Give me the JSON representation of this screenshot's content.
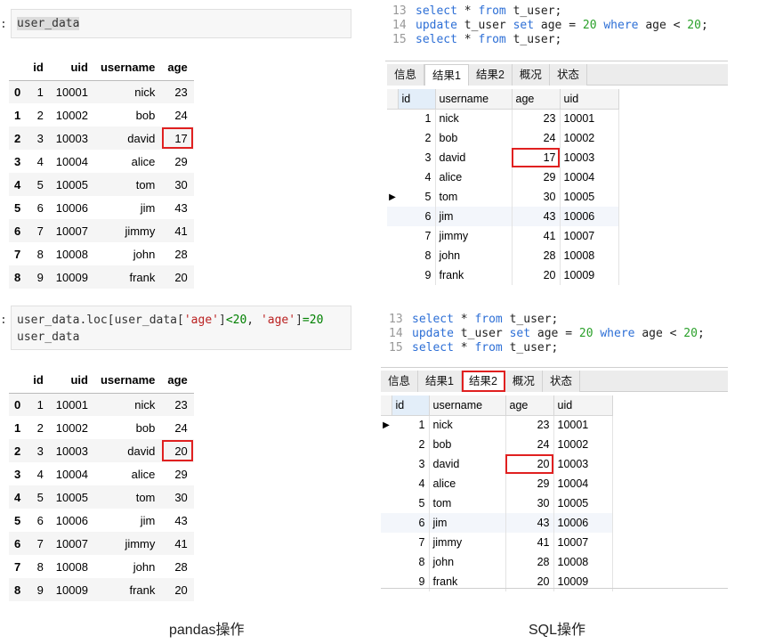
{
  "pandas": {
    "prompt": ":",
    "cell1_code": "user_data",
    "cell2": {
      "prefix": "user_data.loc[user_data[",
      "str1": "'age'",
      "mid1": "]",
      "op1": "<",
      "num1": "20",
      "mid2": ", ",
      "str2": "'age'",
      "mid3": "]",
      "op2": "=",
      "num2": "20",
      "line2": "user_data"
    },
    "columns": [
      "",
      "id",
      "uid",
      "username",
      "age"
    ],
    "table_before": [
      [
        "0",
        "1",
        "10001",
        "nick",
        "23"
      ],
      [
        "1",
        "2",
        "10002",
        "bob",
        "24"
      ],
      [
        "2",
        "3",
        "10003",
        "david",
        "17"
      ],
      [
        "3",
        "4",
        "10004",
        "alice",
        "29"
      ],
      [
        "4",
        "5",
        "10005",
        "tom",
        "30"
      ],
      [
        "5",
        "6",
        "10006",
        "jim",
        "43"
      ],
      [
        "6",
        "7",
        "10007",
        "jimmy",
        "41"
      ],
      [
        "7",
        "8",
        "10008",
        "john",
        "28"
      ],
      [
        "8",
        "9",
        "10009",
        "frank",
        "20"
      ]
    ],
    "table_after": [
      [
        "0",
        "1",
        "10001",
        "nick",
        "23"
      ],
      [
        "1",
        "2",
        "10002",
        "bob",
        "24"
      ],
      [
        "2",
        "3",
        "10003",
        "david",
        "20"
      ],
      [
        "3",
        "4",
        "10004",
        "alice",
        "29"
      ],
      [
        "4",
        "5",
        "10005",
        "tom",
        "30"
      ],
      [
        "5",
        "6",
        "10006",
        "jim",
        "43"
      ],
      [
        "6",
        "7",
        "10007",
        "jimmy",
        "41"
      ],
      [
        "7",
        "8",
        "10008",
        "john",
        "28"
      ],
      [
        "8",
        "9",
        "10009",
        "frank",
        "20"
      ]
    ],
    "caption": "pandas操作"
  },
  "sql": {
    "code_lines": [
      {
        "ln": "13",
        "parts": [
          [
            "kw",
            "select"
          ],
          [
            "plain",
            " * "
          ],
          [
            "kw",
            "from"
          ],
          [
            "plain",
            " t_user;"
          ]
        ]
      },
      {
        "ln": "14",
        "parts": [
          [
            "kw",
            "update"
          ],
          [
            "plain",
            " t_user "
          ],
          [
            "kw",
            "set"
          ],
          [
            "plain",
            " age = "
          ],
          [
            "num",
            "20"
          ],
          [
            "plain",
            " "
          ],
          [
            "kw",
            "where"
          ],
          [
            "plain",
            " age < "
          ],
          [
            "num",
            "20"
          ],
          [
            "plain",
            ";"
          ]
        ]
      },
      {
        "ln": "15",
        "parts": [
          [
            "kw",
            "select"
          ],
          [
            "plain",
            " * "
          ],
          [
            "kw",
            "from"
          ],
          [
            "plain",
            " t_user;"
          ]
        ]
      }
    ],
    "tabs": [
      "信息",
      "结果1",
      "结果2",
      "概况",
      "状态"
    ],
    "columns": [
      "id",
      "username",
      "age",
      "uid"
    ],
    "result1": [
      [
        "1",
        "nick",
        "23",
        "10001"
      ],
      [
        "2",
        "bob",
        "24",
        "10002"
      ],
      [
        "3",
        "david",
        "17",
        "10003"
      ],
      [
        "4",
        "alice",
        "29",
        "10004"
      ],
      [
        "5",
        "tom",
        "30",
        "10005"
      ],
      [
        "6",
        "jim",
        "43",
        "10006"
      ],
      [
        "7",
        "jimmy",
        "41",
        "10007"
      ],
      [
        "8",
        "john",
        "28",
        "10008"
      ],
      [
        "9",
        "frank",
        "20",
        "10009"
      ]
    ],
    "result2": [
      [
        "1",
        "nick",
        "23",
        "10001"
      ],
      [
        "2",
        "bob",
        "24",
        "10002"
      ],
      [
        "3",
        "david",
        "20",
        "10003"
      ],
      [
        "4",
        "alice",
        "29",
        "10004"
      ],
      [
        "5",
        "tom",
        "30",
        "10005"
      ],
      [
        "6",
        "jim",
        "43",
        "10006"
      ],
      [
        "7",
        "jimmy",
        "41",
        "10007"
      ],
      [
        "8",
        "john",
        "28",
        "10008"
      ],
      [
        "9",
        "frank",
        "20",
        "10009"
      ]
    ],
    "row_marker": "▶",
    "caption": "SQL操作"
  },
  "colors": {
    "highlight_box": "#e02020",
    "sql_keyword": "#2d6fd6",
    "sql_number": "#2aa02a"
  }
}
